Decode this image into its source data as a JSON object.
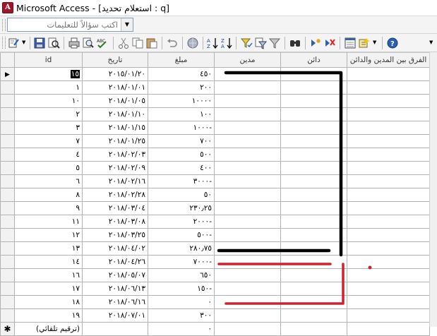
{
  "window": {
    "app_name": "Microsoft Access",
    "title": "Microsoft Access - [استعلام تحديد : q]",
    "icon": "access-app-icon"
  },
  "help": {
    "placeholder": "اكتب سؤالاً للتعليمات"
  },
  "toolbar": {
    "icons": [
      "view-icon",
      "save-icon",
      "search-icon",
      "print-icon",
      "print-preview-icon",
      "spelling-icon",
      "cut-icon",
      "copy-icon",
      "paste-icon",
      "undo-icon",
      "hyperlink-icon",
      "sort-ascending-icon",
      "sort-descending-icon",
      "filter-by-selection-icon",
      "filter-by-form-icon",
      "apply-filter-icon",
      "find-icon",
      "new-record-icon",
      "delete-record-icon",
      "database-window-icon",
      "new-object-icon",
      "help-icon"
    ]
  },
  "table": {
    "columns": {
      "id": "id",
      "date": "تاريخ",
      "amount": "مبلغ",
      "debtor": "مدين",
      "creditor": "دائن",
      "difference": "الفرق بين المدين والدائن"
    },
    "rows": [
      {
        "id": "١٥",
        "date": "٢٠١٥/٠١/٢٠",
        "amount": "٤٥٠"
      },
      {
        "id": "١",
        "date": "٢٠١٨/٠١/٠١",
        "amount": "٢٠٠"
      },
      {
        "id": "١٠",
        "date": "٢٠١٨/٠١/٠٥",
        "amount": "١٠٠٠٠"
      },
      {
        "id": "٢",
        "date": "٢٠١٨/٠١/١٠",
        "amount": "١٠٠"
      },
      {
        "id": "٣",
        "date": "٢٠١٨/٠١/١٥",
        "amount": "-١٠٠٠"
      },
      {
        "id": "٧",
        "date": "٢٠١٨/٠١/٢٥",
        "amount": "٧٠٠"
      },
      {
        "id": "٤",
        "date": "٢٠١٨/٠٢/٠٣",
        "amount": "٥٠٠"
      },
      {
        "id": "٥",
        "date": "٢٠١٨/٠٢/٠٩",
        "amount": "٤٠٠"
      },
      {
        "id": "٦",
        "date": "٢٠١٨/٠٢/١٦",
        "amount": "-٣٠٠٠"
      },
      {
        "id": "٨",
        "date": "٢٠١٨/٠٢/٢٨",
        "amount": "٥٠"
      },
      {
        "id": "٩",
        "date": "٢٠١٨/٠٣/٠٤",
        "amount": "٢٣٠٫٢٥"
      },
      {
        "id": "١١",
        "date": "٢٠١٨/٠٣/٠٨",
        "amount": "-٢٠٠٠"
      },
      {
        "id": "١٢",
        "date": "٢٠١٨/٠٣/٢٥",
        "amount": "-٥٠٠"
      },
      {
        "id": "١٣",
        "date": "٢٠١٨/٠٤/٠٢",
        "amount": "٢٨٠٫٧٥"
      },
      {
        "id": "١٤",
        "date": "٢٠١٨/٠٤/٢٦",
        "amount": "-٧٠٠٠"
      },
      {
        "id": "١٦",
        "date": "٢٠١٨/٠٥/٠٧",
        "amount": "٦٥٠"
      },
      {
        "id": "١٧",
        "date": "٢٠١٨/٠٦/١٣",
        "amount": "-١٥٠"
      },
      {
        "id": "١٨",
        "date": "٢٠١٨/٠٦/١٦",
        "amount": "٠"
      },
      {
        "id": "١٩",
        "date": "٢٠١٨/٠٧/٠١",
        "amount": "٣٠٠"
      }
    ],
    "new_row": {
      "id": "(ترقيم تلقائي)",
      "amount": "٠"
    }
  },
  "colors": {
    "annotation_black": "#000000",
    "annotation_red": "#cc2233",
    "grid_line": "#b3b3b3",
    "header_bg": "#f2f2f2"
  }
}
